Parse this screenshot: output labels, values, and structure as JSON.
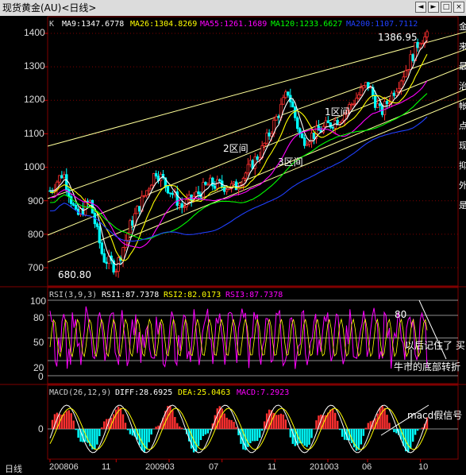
{
  "window": {
    "title": "现货黄金(AU)<日线>",
    "buttons": [
      "◄",
      "►",
      "□",
      "×"
    ]
  },
  "main_panel": {
    "header": {
      "prefix": "K",
      "ma": [
        {
          "label": "MA9:1347.6778",
          "color": "#ffffff"
        },
        {
          "label": "MA26:1304.8269",
          "color": "#ffff00"
        },
        {
          "label": "MA55:1261.1689",
          "color": "#ff00ff"
        },
        {
          "label": "MA120:1233.6627",
          "color": "#00ff00"
        },
        {
          "label": "MA200:1107.7112",
          "color": "#2040ff"
        }
      ]
    },
    "y_ticks": [
      "1400",
      "1300",
      "1200",
      "1100",
      "1000",
      "900",
      "800",
      "700"
    ],
    "high_label": "1386.95",
    "low_label": "680.80",
    "annotations": [
      "1区间",
      "2区间",
      "3区间"
    ]
  },
  "rsi_panel": {
    "header": {
      "name": "RSI(3,9,3)",
      "rsi1": "RSI1:87.7378",
      "rsi2": "RSI2:82.0173",
      "rsi3": "RSI3:87.7378"
    },
    "y_ticks": [
      "100",
      "80",
      "50",
      "20",
      "0"
    ],
    "level_label": "80",
    "annotations": [
      "以后记住了 买",
      "牛市的底部转折"
    ]
  },
  "macd_panel": {
    "header": {
      "name": "MACD(26,12,9)",
      "diff": "DIFF:28.6925",
      "dea": "DEA:25.0463",
      "macd": "MACD:7.2923"
    },
    "y_ticks": [
      "0"
    ],
    "annotation": "macd假信号"
  },
  "x_axis": {
    "label": "日线",
    "ticks": [
      "200806",
      "11",
      "200903",
      "07",
      "11",
      "201003",
      "06",
      "10"
    ]
  },
  "side_text": [
    "金",
    "来",
    "最",
    "治",
    "帐",
    "点",
    "现",
    "抑",
    "外",
    "是"
  ],
  "colors": {
    "up": "#ff3030",
    "down": "#00ffff",
    "grid": "#800000",
    "trendline": "#ffff99",
    "rsi_main": "#ff00ff",
    "rsi_secondary": "#ffff00",
    "macd_diff": "#ffffff",
    "macd_dea": "#ffff00"
  },
  "chart_data": {
    "type": "candlestick",
    "title": "现货黄金(AU)<日线>",
    "x_range": [
      "2008-06",
      "2010-10"
    ],
    "y_range": [
      680.8,
      1386.95
    ],
    "price_keypoints": [
      {
        "x": "2008-06",
        "y": 930
      },
      {
        "x": "2008-07",
        "y": 985
      },
      {
        "x": "2008-08",
        "y": 850
      },
      {
        "x": "2008-09",
        "y": 900
      },
      {
        "x": "2008-10",
        "y": 730
      },
      {
        "x": "2008-11",
        "y": 700
      },
      {
        "x": "2008-12",
        "y": 820
      },
      {
        "x": "2009-02",
        "y": 990
      },
      {
        "x": "2009-04",
        "y": 880
      },
      {
        "x": "2009-06",
        "y": 950
      },
      {
        "x": "2009-08",
        "y": 940
      },
      {
        "x": "2009-10",
        "y": 1050
      },
      {
        "x": "2009-12",
        "y": 1226
      },
      {
        "x": "2010-01",
        "y": 1080
      },
      {
        "x": "2010-02",
        "y": 1100
      },
      {
        "x": "2010-04",
        "y": 1150
      },
      {
        "x": "2010-06",
        "y": 1250
      },
      {
        "x": "2010-07",
        "y": 1160
      },
      {
        "x": "2010-08",
        "y": 1230
      },
      {
        "x": "2010-09",
        "y": 1300
      },
      {
        "x": "2010-10",
        "y": 1386.95
      }
    ],
    "moving_averages": [
      {
        "name": "MA9",
        "value": 1347.6778
      },
      {
        "name": "MA26",
        "value": 1304.8269
      },
      {
        "name": "MA55",
        "value": 1261.1689
      },
      {
        "name": "MA120",
        "value": 1233.6627
      },
      {
        "name": "MA200",
        "value": 1107.7112
      }
    ]
  }
}
